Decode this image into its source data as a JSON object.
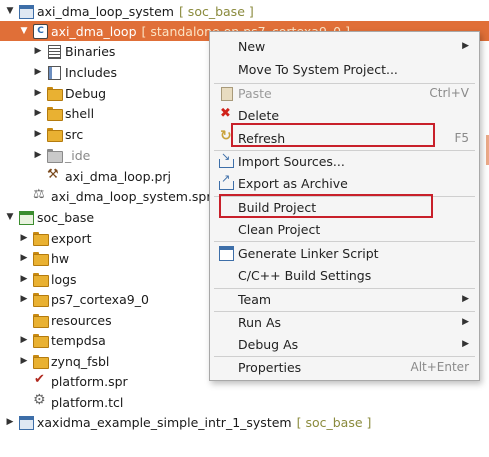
{
  "tree": {
    "rows": [
      {
        "label": "axi_dma_loop_system",
        "annotation": "[ soc_base ]",
        "twisty": "▼",
        "icon": "sys-icon"
      },
      {
        "label": "axi_dma_loop",
        "annotation": "[ standalone on ps7_cortexa9_0 ]",
        "twisty": "▼",
        "icon": "app-project-icon"
      },
      {
        "label": "Binaries",
        "twisty": "▶",
        "icon": "binaries-icon"
      },
      {
        "label": "Includes",
        "twisty": "▶",
        "icon": "includes-icon"
      },
      {
        "label": "Debug",
        "twisty": "▶",
        "icon": "folder-icon"
      },
      {
        "label": "shell",
        "twisty": "▶",
        "icon": "folder-icon"
      },
      {
        "label": "src",
        "twisty": "▶",
        "icon": "folder-icon"
      },
      {
        "label": "_ide",
        "twisty": "▶",
        "icon": "folder-icon"
      },
      {
        "label": "axi_dma_loop.prj",
        "icon": "prj-icon"
      },
      {
        "label": "axi_dma_loop_system.sprj",
        "icon": "sprj-icon"
      },
      {
        "label": "soc_base",
        "twisty": "▼",
        "icon": "platform-icon"
      },
      {
        "label": "export",
        "twisty": "▶",
        "icon": "folder-icon"
      },
      {
        "label": "hw",
        "twisty": "▶",
        "icon": "folder-icon"
      },
      {
        "label": "logs",
        "twisty": "▶",
        "icon": "folder-icon"
      },
      {
        "label": "ps7_cortexa9_0",
        "twisty": "▶",
        "icon": "folder-icon"
      },
      {
        "label": "resources",
        "icon": "folder-icon"
      },
      {
        "label": "tempdsa",
        "twisty": "▶",
        "icon": "folder-icon"
      },
      {
        "label": "zynq_fsbl",
        "twisty": "▶",
        "icon": "folder-icon"
      },
      {
        "label": "platform.spr",
        "icon": "spr-icon"
      },
      {
        "label": "platform.tcl",
        "icon": "tcl-icon"
      },
      {
        "label": "xaxidma_example_simple_intr_1_system",
        "annotation": "[ soc_base ]",
        "twisty": "▶",
        "icon": "sys-icon"
      }
    ]
  },
  "menu": {
    "items": [
      {
        "label": "New",
        "submenu": true
      },
      {
        "label": "Move To System Project..."
      },
      {
        "label": "Paste",
        "shortcut": "Ctrl+V",
        "disabled": true,
        "icon": "paste-icon"
      },
      {
        "label": "Delete",
        "icon": "delete-icon"
      },
      {
        "label": "Refresh",
        "shortcut": "F5",
        "icon": "refresh-icon",
        "highlighted": true
      },
      {
        "label": "Import Sources...",
        "icon": "import-icon"
      },
      {
        "label": "Export as Archive",
        "icon": "export-icon"
      },
      {
        "label": "Build Project",
        "highlighted": true
      },
      {
        "label": "Clean Project"
      },
      {
        "label": "Generate Linker Script",
        "icon": "linker-script-icon"
      },
      {
        "label": "C/C++ Build Settings"
      },
      {
        "label": "Team",
        "submenu": true
      },
      {
        "label": "Run As",
        "submenu": true
      },
      {
        "label": "Debug As",
        "submenu": true
      },
      {
        "label": "Properties",
        "shortcut": "Alt+Enter"
      }
    ],
    "submenu_arrow": "▶"
  },
  "colors": {
    "selection": "#e06f38",
    "highlight_box": "#c8202a",
    "annotation": "#8a8a3c"
  }
}
